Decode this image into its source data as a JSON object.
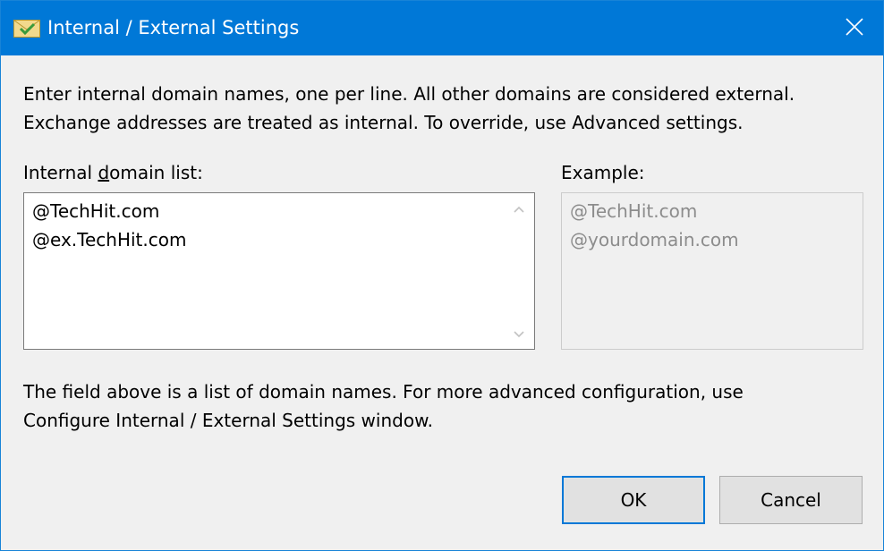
{
  "window": {
    "title": "Internal / External Settings",
    "title_icon": "envelope-check-icon",
    "close_icon": "close-icon"
  },
  "intro": {
    "line1": "Enter internal domain names, one per line. All other domains are considered external.",
    "line2": "Exchange addresses are treated as internal. To override, use Advanced settings."
  },
  "internal_list": {
    "label_pre": "Internal ",
    "label_accel": "d",
    "label_post": "omain list:",
    "value": "@TechHit.com\n@ex.TechHit.com"
  },
  "example": {
    "label": "Example:",
    "line1": "@TechHit.com",
    "line2": "@yourdomain.com"
  },
  "footer": {
    "line1": "The field above is a list of domain names. For more advanced configuration, use",
    "line2": "Configure Internal / External Settings window."
  },
  "buttons": {
    "ok": "OK",
    "cancel": "Cancel"
  },
  "colors": {
    "titlebar": "#0078d7",
    "dialog_bg": "#f0f0f0",
    "placeholder_text": "#8c8c8c"
  }
}
